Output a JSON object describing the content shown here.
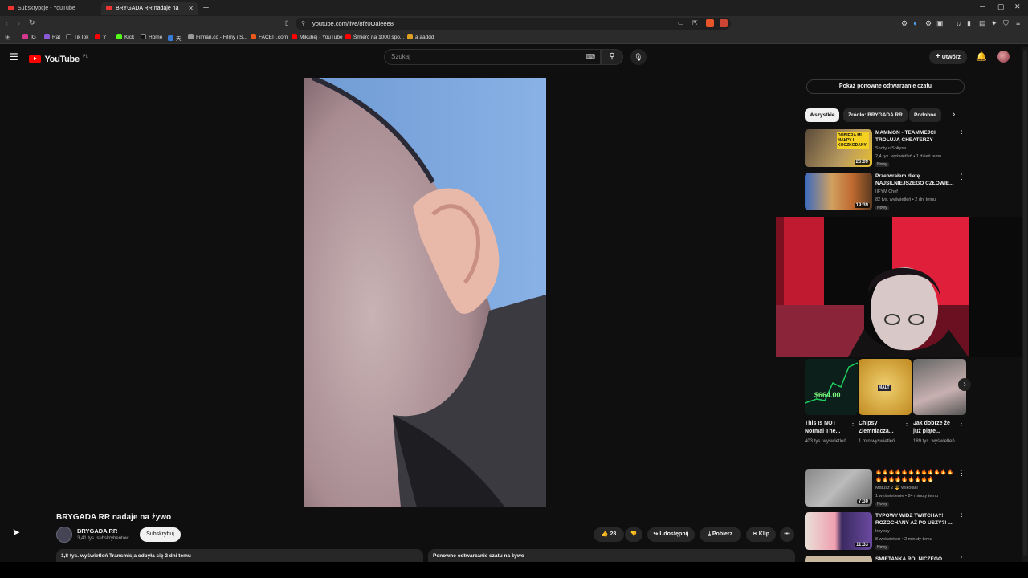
{
  "browser": {
    "tabs": [
      {
        "title": "Subskrypcje - YouTube"
      },
      {
        "title": "BRYGADA RR nadaje na żywo"
      }
    ],
    "url": "youtube.com/live/8fz0Oaieee8",
    "bookmarks": [
      "IG",
      "Rat",
      "TikTok",
      "YT",
      "Kick",
      "Home",
      "天",
      "Filman.cc - Filmy i S...",
      "FACEIT.com",
      "Mikuhej - YouTube",
      "Śmierć na 1000 spo...",
      "a aaddd"
    ]
  },
  "header": {
    "logo": "YouTube",
    "region": "PL",
    "search_placeholder": "Szukaj",
    "create_label": "Utwórz"
  },
  "video": {
    "title": "BRYGADA RR nadaje na żywo",
    "channel": "BRYGADA RR",
    "subscribers": "3,41 tys. subskrybentów",
    "subscribe_label": "Subskrybuj",
    "likes": "28",
    "share_label": "Udostępnij",
    "download_label": "Pobierz",
    "clip_label": "Klip",
    "description_stats": "1,8 tys. wyświetleń  Transmisja odbyła się 2 dni temu",
    "chat_replay_panel": "Ponowne odtwarzanie czatu na żywo"
  },
  "sidebar": {
    "chat_replay_button": "Pokaż ponowne odtwarzanie czatu",
    "chips": [
      "Wszystkie",
      "Źródło: BRYGADA RR",
      "Podobne"
    ],
    "recommendations_top": [
      {
        "title": "MAMMON - TEAMMEJCI TROLUJĄ CHEATERZY CZITUJ...",
        "channel": "Shoty u Sołtysa",
        "meta": "2,4 tys. wyświetleń • 1 dzień temu",
        "badge": "Nowy",
        "duration": "26:09",
        "thumb_text": "DOBIERA MI MAŁPY I KOCZKODANY"
      },
      {
        "title": "Przetwrałem dietę NAJSILNIEJSZEGO CZŁOWIE...",
        "channel": "IIFYM Chef",
        "meta": "82 tys. wyświetleń • 2 dni temu",
        "badge": "Nowy",
        "duration": "19:39",
        "thumb_text": ""
      }
    ],
    "shorts": [
      {
        "title": "This Is NOT Normal The...",
        "views": "403 tys. wyświetleń",
        "thumb_text": "$664.00"
      },
      {
        "title": "Chipsy Ziemniacza...",
        "views": "1 mln wyświetleń",
        "thumb_text": "MALT"
      },
      {
        "title": "Jak dobrze że już piąte...",
        "views": "189 tys. wyświetleń",
        "thumb_text": ""
      }
    ],
    "recommendations_bottom": [
      {
        "title": "🔥🔥🔥🔥🔥🔥🔥🔥🔥🔥🔥🔥🔥🔥🔥🔥🔥🔥🔥🔥🔥",
        "channel": "Matusz 2 🔱 wilkołaki",
        "meta": "1 wyświetlenie • 24 minuty temu",
        "badge": "Nowy",
        "duration": "7:30"
      },
      {
        "title": "TYPOWY WIDZ TWITCHA?! ROZOCHANY AŻ PO USZY?! ...",
        "channel": "Irzytrzy",
        "meta": "8 wyświetleń • 2 minuty temu",
        "badge": "Nowy",
        "duration": "11:33"
      },
      {
        "title": "ŚMIETANKA ROLNICZEGO",
        "channel": "",
        "meta": "",
        "badge": "",
        "duration": ""
      }
    ]
  }
}
